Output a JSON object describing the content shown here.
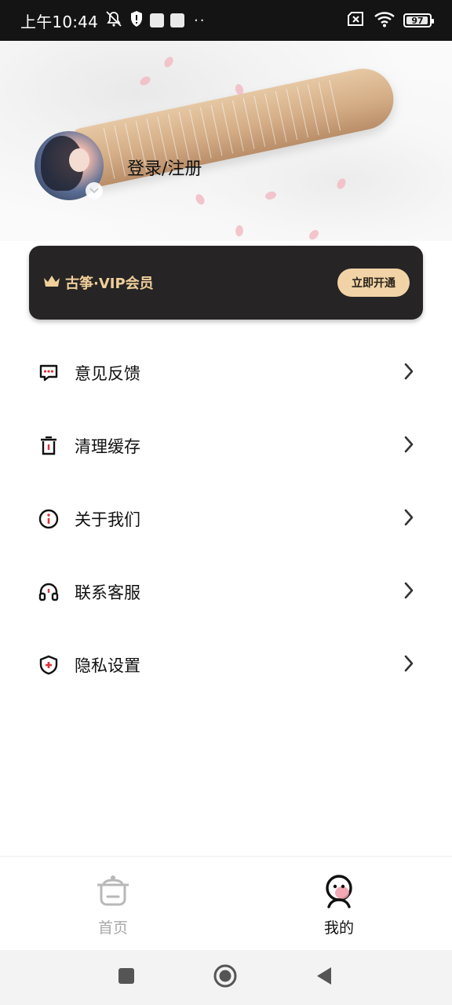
{
  "status_bar": {
    "time": "上午10:44",
    "battery_level": "97",
    "battery_fraction": 0.97,
    "icons": [
      "mute-icon",
      "shield-icon",
      "notification-square-icon",
      "notification-square-icon",
      "more-dots-icon",
      "sim-off-icon",
      "wifi-icon",
      "battery-icon"
    ]
  },
  "header": {
    "login_label": "登录/注册",
    "avatar_icon": "avatar",
    "expand_icon": "chevron-down-icon"
  },
  "vip": {
    "title": "古筝·VIP会员",
    "button_label": "立即开通",
    "accent_color": "#f0cf9b",
    "button_color": "#f1d3a7",
    "card_color": "#262424"
  },
  "menu": {
    "items": [
      {
        "label": "意见反馈",
        "icon": "feedback-icon"
      },
      {
        "label": "清理缓存",
        "icon": "trash-icon"
      },
      {
        "label": "关于我们",
        "icon": "info-icon"
      },
      {
        "label": "联系客服",
        "icon": "headset-icon"
      },
      {
        "label": "隐私设置",
        "icon": "privacy-shield-icon"
      }
    ]
  },
  "tab_bar": {
    "tabs": [
      {
        "label": "首页",
        "icon": "home-icon",
        "active": false
      },
      {
        "label": "我的",
        "icon": "profile-icon",
        "active": true
      }
    ],
    "active_color": "#111111",
    "inactive_color": "#a8a8a8",
    "accent_pink": "#f19aa6"
  },
  "nav_bar": {
    "buttons": [
      "recents-button",
      "home-button",
      "back-button"
    ]
  }
}
